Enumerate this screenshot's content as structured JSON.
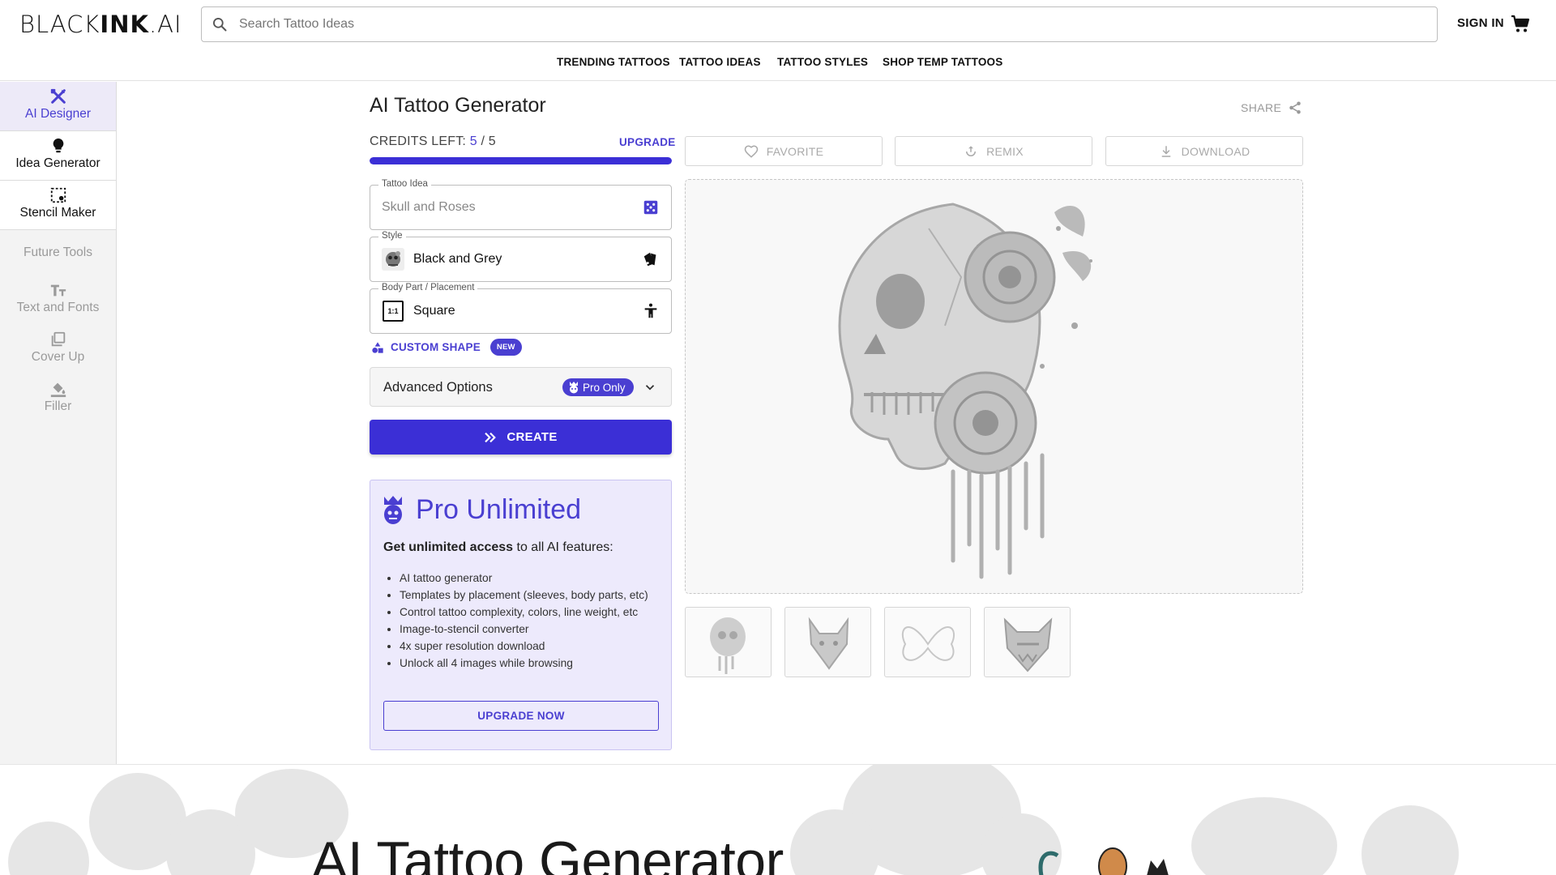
{
  "brand": {
    "logo_left": "BLACK",
    "logo_mid": "INK",
    "logo_right": ".AI"
  },
  "search": {
    "placeholder": "Search Tattoo Ideas"
  },
  "header": {
    "signin_label": "SIGN IN"
  },
  "topnav": {
    "trending": "TRENDING TATTOOS",
    "ideas": "TATTOO IDEAS",
    "styles": "TATTOO STYLES",
    "shop": "SHOP TEMP TATTOOS"
  },
  "sidebar": {
    "ai_designer": "AI Designer",
    "idea_generator": "Idea Generator",
    "stencil_maker": "Stencil Maker",
    "future_heading": "Future Tools",
    "text_fonts": "Text and Fonts",
    "cover_up": "Cover Up",
    "filler": "Filler"
  },
  "main": {
    "title": "AI Tattoo Generator",
    "share_label": "SHARE",
    "credits_label": "CREDITS LEFT:",
    "credits_used": "5",
    "credits_sep": "/",
    "credits_total": "5",
    "credits_fraction": 1.0,
    "upgrade_label": "UPGRADE"
  },
  "form": {
    "idea_legend": "Tattoo Idea",
    "idea_placeholder": "Skull and Roses",
    "style_legend": "Style",
    "style_value": "Black and Grey",
    "placement_legend": "Body Part / Placement",
    "placement_value": "Square",
    "placement_icon_text": "1:1",
    "custom_shape_label": "CUSTOM SHAPE",
    "new_badge": "NEW",
    "advanced_label": "Advanced Options",
    "pro_only_label": "Pro Only",
    "create_label": "CREATE"
  },
  "pro_card": {
    "title": "Pro Unlimited",
    "lead_bold": "Get unlimited access",
    "lead_rest": " to all AI features:",
    "features": [
      "AI tattoo generator",
      "Templates by placement (sleeves, body parts, etc)",
      "Control tattoo complexity, colors, line weight, etc",
      "Image-to-stencil converter",
      "4x super resolution download",
      "Unlock all 4 images while browsing"
    ],
    "upgrade_now_label": "UPGRADE NOW"
  },
  "actions": {
    "favorite": "FAVORITE",
    "remix": "REMIX",
    "download": "DOWNLOAD"
  },
  "thumbnails": [
    "skull-thumb",
    "wolf-thumb",
    "butterfly-thumb",
    "demon-thumb"
  ],
  "hero": {
    "title": "AI Tattoo Generator"
  },
  "colors": {
    "accent": "#4a3fd1",
    "accent_dark": "#3b2fd6",
    "pro_bg": "#edeafc",
    "sidebar_active": "#edeaf8"
  }
}
